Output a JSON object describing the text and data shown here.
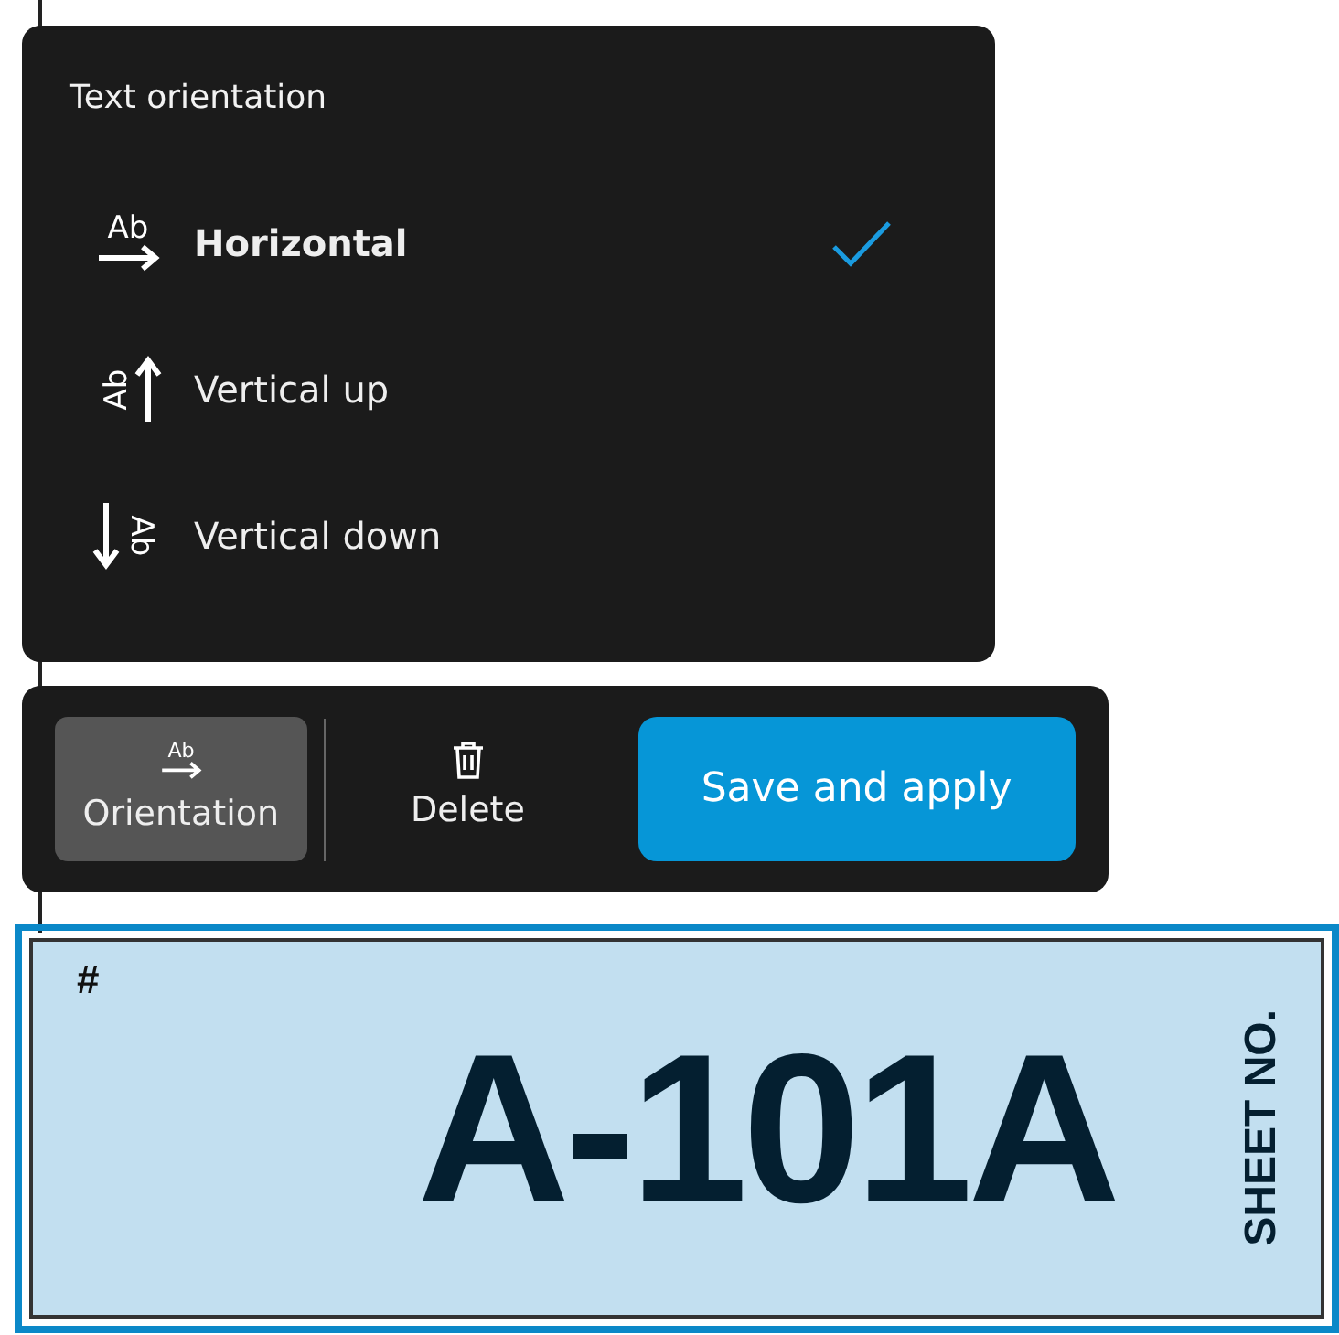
{
  "menu": {
    "title": "Text orientation",
    "items": [
      {
        "label": "Horizontal",
        "kind": "horizontal",
        "icon_text": "Ab",
        "selected": true
      },
      {
        "label": "Vertical up",
        "kind": "up",
        "icon_text": "Ab",
        "selected": false
      },
      {
        "label": "Vertical down",
        "kind": "down",
        "icon_text": "Ab",
        "selected": false
      }
    ]
  },
  "toolbar": {
    "buttons": [
      {
        "label": "Orientation",
        "kind": "orientation",
        "icon_text": "Ab",
        "active": true
      },
      {
        "label": "Delete",
        "kind": "delete",
        "active": false
      }
    ],
    "primary": "Save and apply"
  },
  "sheet": {
    "mark": "#",
    "number": "A-101A",
    "label": "SHEET NO.",
    "selected": true
  }
}
